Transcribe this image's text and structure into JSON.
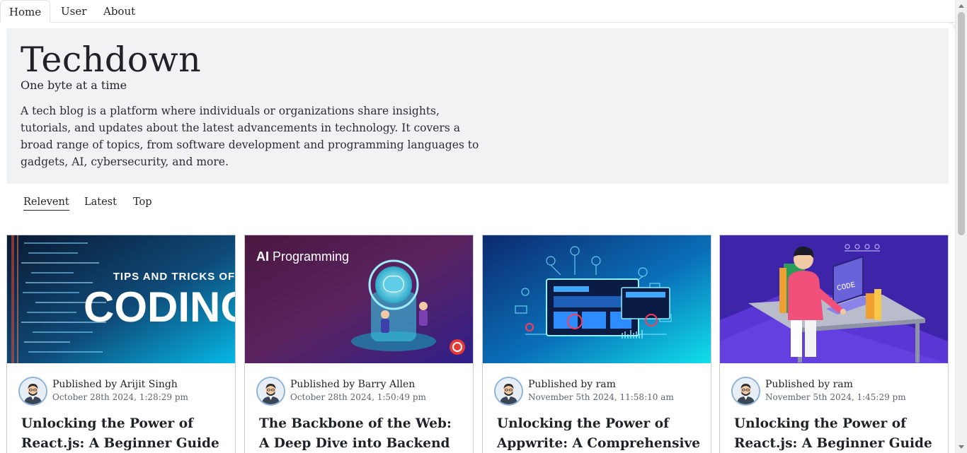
{
  "nav": {
    "tabs": [
      {
        "label": "Home"
      },
      {
        "label": "User"
      },
      {
        "label": "About"
      }
    ]
  },
  "hero": {
    "title": "Techdown",
    "tagline": "One byte at a time",
    "description": "A tech blog is a platform where individuals or organizations share insights, tutorials, and updates about the latest advancements in technology. It covers a broad range of topics, from software development and programming languages to gadgets, AI, cybersecurity, and more."
  },
  "filters": [
    {
      "label": "Relevent"
    },
    {
      "label": "Latest"
    },
    {
      "label": "Top"
    }
  ],
  "posts": [
    {
      "author": "Published by Arijit Singh",
      "date": "October 28th 2024, 1:28:29 pm",
      "title": "Unlocking the Power of React.js: A Beginner Guide",
      "image_text_top": "TIPS AND TRICKS OF",
      "image_text_main": "CODING"
    },
    {
      "author": "Published by Barry Allen",
      "date": "October 28th 2024, 1:50:49 pm",
      "title": "The Backbone of the Web: A Deep Dive into Backend Web",
      "image_text_bold": "AI",
      "image_text_rest": " Programming"
    },
    {
      "author": "Published by ram",
      "date": "November 5th 2024, 11:58:10 am",
      "title": "Unlocking the Power of Appwrite: A Comprehensive Guide"
    },
    {
      "author": "Published by ram",
      "date": "November 5th 2024, 1:45:29 pm",
      "title": "Unlocking the Power of React.js: A Beginner Guide",
      "image_text_main": "CODE"
    }
  ],
  "colors": {
    "hero_bg": "#f1f2f4",
    "card_border": "#c9cdd2",
    "avatar_ring": "#8fb2d8"
  }
}
